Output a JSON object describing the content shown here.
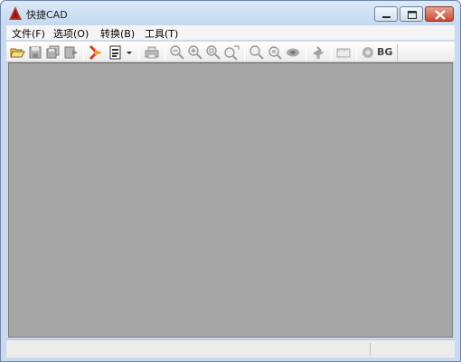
{
  "window": {
    "title": "快捷CAD",
    "controls": {
      "minimize": "minimize",
      "maximize": "maximize",
      "close": "close"
    }
  },
  "menu": [
    {
      "label": "文件(F)"
    },
    {
      "label": "选项(O)"
    },
    {
      "label": "转换(B)"
    },
    {
      "label": "工具(T)"
    }
  ],
  "toolbar": {
    "bg_label": "BG",
    "icons": [
      "open-folder-icon",
      "save-icon",
      "save-all-icon",
      "export-icon",
      "cad-logo-icon",
      "print-preview-icon",
      "dropdown-arrow-icon",
      "print-icon",
      "zoom-out-icon",
      "zoom-in-icon",
      "zoom-window-icon",
      "zoom-extents-icon",
      "zoom-realtime-icon",
      "zoom-previous-icon",
      "pan-icon",
      "layer-icon",
      "measure-icon",
      "settings-icon"
    ]
  },
  "colors": {
    "titlebar": "#c9daf0",
    "canvas": "#a6a6a6",
    "close_button": "#c64a2f",
    "accent_orange": "#e86a1a"
  },
  "status": {
    "text": ""
  }
}
